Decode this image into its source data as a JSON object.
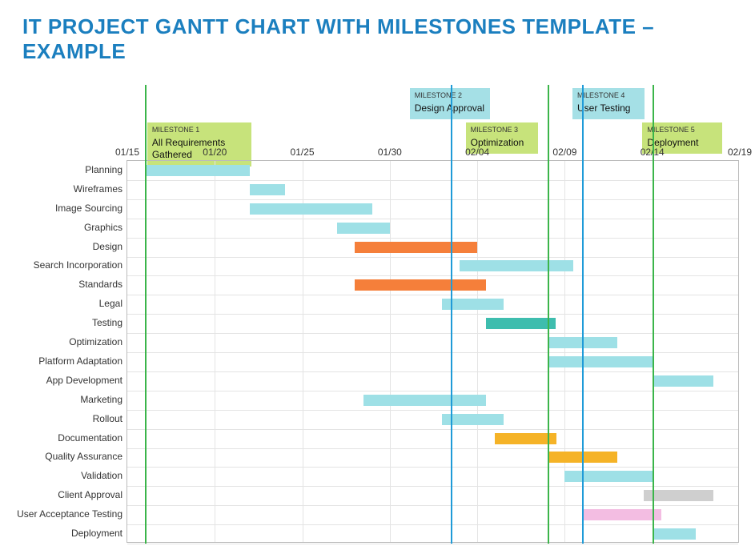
{
  "title": "IT PROJECT GANTT CHART WITH MILESTONES TEMPLATE – EXAMPLE",
  "chart_data": {
    "type": "gantt",
    "x_axis": {
      "start": "01/15",
      "end": "02/19",
      "ticks": [
        "01/15",
        "01/20",
        "01/25",
        "01/30",
        "02/04",
        "02/09",
        "02/14",
        "02/19"
      ]
    },
    "milestones": [
      {
        "num": "MILESTONE 1",
        "name": "All Requirements Gathered",
        "date_index": 1,
        "color": "green"
      },
      {
        "num": "MILESTONE 2",
        "name": "Design Approval",
        "date_index": 18.5,
        "color": "blue"
      },
      {
        "num": "MILESTONE 3",
        "name": "Optimization",
        "date_index": 24,
        "color": "green"
      },
      {
        "num": "MILESTONE 4",
        "name": "User Testing",
        "date_index": 26,
        "color": "blue"
      },
      {
        "num": "MILESTONE 5",
        "name": "Deployment",
        "date_index": 30,
        "color": "green"
      }
    ],
    "tasks": [
      {
        "label": "Planning",
        "start": 1,
        "end": 7,
        "color": "light"
      },
      {
        "label": "Wireframes",
        "start": 7,
        "end": 9,
        "color": "light"
      },
      {
        "label": "Image Sourcing",
        "start": 7,
        "end": 14,
        "color": "light"
      },
      {
        "label": "Graphics",
        "start": 12,
        "end": 15,
        "color": "light"
      },
      {
        "label": "Design",
        "start": 13,
        "end": 20,
        "color": "orange"
      },
      {
        "label": "Search Incorporation",
        "start": 19,
        "end": 25.5,
        "color": "light"
      },
      {
        "label": "Standards",
        "start": 13,
        "end": 20.5,
        "color": "orange"
      },
      {
        "label": "Legal",
        "start": 18,
        "end": 21.5,
        "color": "light"
      },
      {
        "label": "Testing",
        "start": 20.5,
        "end": 24.5,
        "color": "teal"
      },
      {
        "label": "Optimization",
        "start": 24,
        "end": 28,
        "color": "light"
      },
      {
        "label": "Platform Adaptation",
        "start": 24,
        "end": 30,
        "color": "light"
      },
      {
        "label": "App Development",
        "start": 30,
        "end": 33.5,
        "color": "light"
      },
      {
        "label": "Marketing",
        "start": 13.5,
        "end": 20.5,
        "color": "light"
      },
      {
        "label": "Rollout",
        "start": 18,
        "end": 21.5,
        "color": "light"
      },
      {
        "label": "Documentation",
        "start": 21,
        "end": 24.5,
        "color": "amber"
      },
      {
        "label": "Quality Assurance",
        "start": 24,
        "end": 28,
        "color": "amber"
      },
      {
        "label": "Validation",
        "start": 25,
        "end": 30,
        "color": "light"
      },
      {
        "label": "Client Approval",
        "start": 29.5,
        "end": 33.5,
        "color": "gray"
      },
      {
        "label": "User Acceptance Testing",
        "start": 26,
        "end": 30.5,
        "color": "pink"
      },
      {
        "label": "Deployment",
        "start": 30,
        "end": 32.5,
        "color": "light"
      }
    ]
  }
}
